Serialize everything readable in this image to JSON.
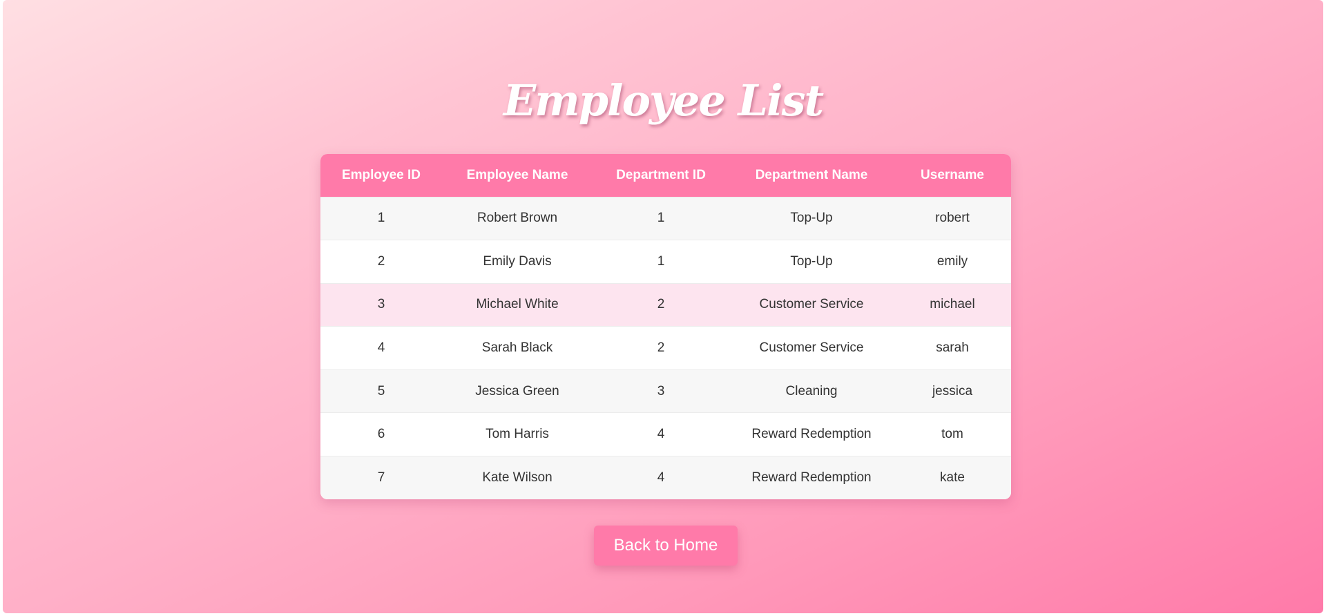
{
  "page": {
    "title": "Employee List"
  },
  "table": {
    "headers": [
      "Employee ID",
      "Employee Name",
      "Department ID",
      "Department Name",
      "Username"
    ],
    "rows": [
      [
        "1",
        "Robert Brown",
        "1",
        "Top-Up",
        "robert"
      ],
      [
        "2",
        "Emily Davis",
        "1",
        "Top-Up",
        "emily"
      ],
      [
        "3",
        "Michael White",
        "2",
        "Customer Service",
        "michael"
      ],
      [
        "4",
        "Sarah Black",
        "2",
        "Customer Service",
        "sarah"
      ],
      [
        "5",
        "Jessica Green",
        "3",
        "Cleaning",
        "jessica"
      ],
      [
        "6",
        "Tom Harris",
        "4",
        "Reward Redemption",
        "tom"
      ],
      [
        "7",
        "Kate Wilson",
        "4",
        "Reward Redemption",
        "kate"
      ]
    ],
    "highlighted_row": 3
  },
  "actions": {
    "back_label": "Back to Home"
  },
  "colors": {
    "accent": "#ff7aa9",
    "header_text": "#ffffff",
    "highlight_row": "#fde4ef"
  }
}
